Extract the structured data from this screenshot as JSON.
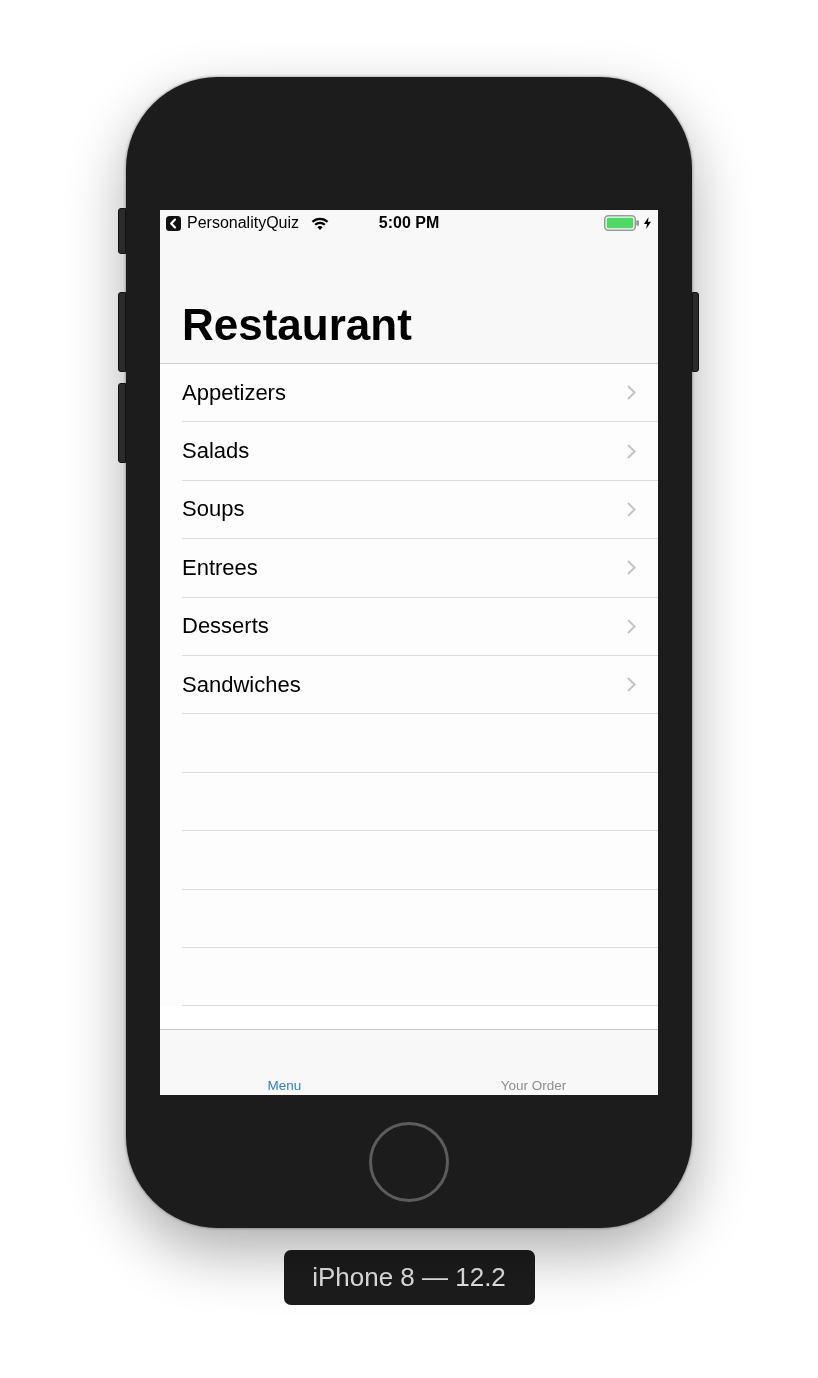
{
  "status_bar": {
    "back_app": "PersonalityQuiz",
    "time": "5:00 PM",
    "charging": true
  },
  "navigation_bar": {
    "title": "Restaurant"
  },
  "list": {
    "rows": [
      {
        "label": "Appetizers"
      },
      {
        "label": "Salads"
      },
      {
        "label": "Soups"
      },
      {
        "label": "Entrees"
      },
      {
        "label": "Desserts"
      },
      {
        "label": "Sandwiches"
      }
    ]
  },
  "tab_bar": {
    "tabs": [
      {
        "label": "Menu",
        "selected": true
      },
      {
        "label": "Your Order",
        "selected": false
      }
    ]
  },
  "device": {
    "label": "iPhone 8 — 12.2"
  }
}
